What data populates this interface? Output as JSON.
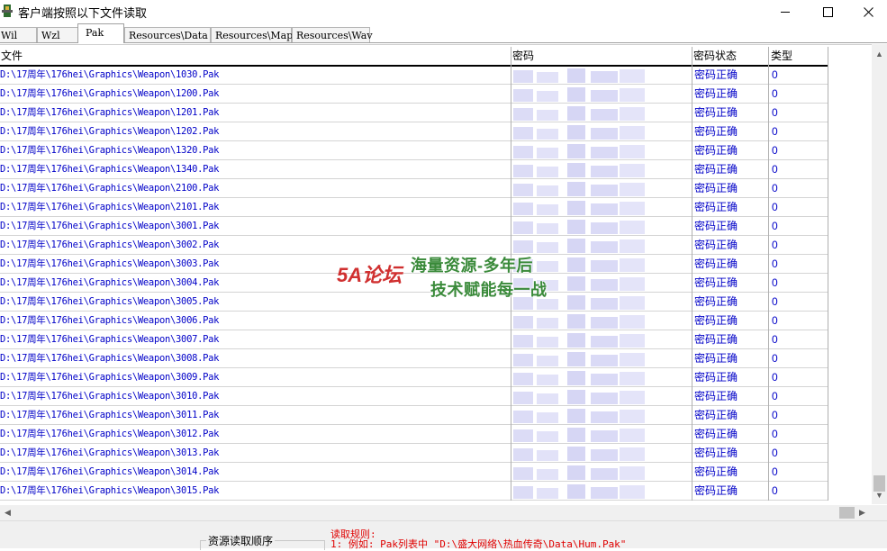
{
  "window": {
    "title": "客户端按照以下文件读取",
    "icon": "app-icon",
    "controls": [
      "minimize-icon",
      "maximize-icon",
      "close-icon"
    ]
  },
  "tabs": [
    {
      "label": "Wil",
      "active": false
    },
    {
      "label": "Wzl",
      "active": false
    },
    {
      "label": "Pak",
      "active": true
    },
    {
      "label": "Resources\\Data",
      "active": false
    },
    {
      "label": "Resources\\Map",
      "active": false
    },
    {
      "label": "Resources\\Wav",
      "active": false
    }
  ],
  "grid": {
    "columns": {
      "file": "文件",
      "password": "密码",
      "status": "密码状态",
      "type": "类型"
    },
    "rows": [
      {
        "file": "D:\\17周年\\176hei\\Graphics\\Weapon\\1030.Pak",
        "status": "密码正确",
        "type": "0"
      },
      {
        "file": "D:\\17周年\\176hei\\Graphics\\Weapon\\1200.Pak",
        "status": "密码正确",
        "type": "0"
      },
      {
        "file": "D:\\17周年\\176hei\\Graphics\\Weapon\\1201.Pak",
        "status": "密码正确",
        "type": "0"
      },
      {
        "file": "D:\\17周年\\176hei\\Graphics\\Weapon\\1202.Pak",
        "status": "密码正确",
        "type": "0"
      },
      {
        "file": "D:\\17周年\\176hei\\Graphics\\Weapon\\1320.Pak",
        "status": "密码正确",
        "type": "0"
      },
      {
        "file": "D:\\17周年\\176hei\\Graphics\\Weapon\\1340.Pak",
        "status": "密码正确",
        "type": "0"
      },
      {
        "file": "D:\\17周年\\176hei\\Graphics\\Weapon\\2100.Pak",
        "status": "密码正确",
        "type": "0"
      },
      {
        "file": "D:\\17周年\\176hei\\Graphics\\Weapon\\2101.Pak",
        "status": "密码正确",
        "type": "0"
      },
      {
        "file": "D:\\17周年\\176hei\\Graphics\\Weapon\\3001.Pak",
        "status": "密码正确",
        "type": "0"
      },
      {
        "file": "D:\\17周年\\176hei\\Graphics\\Weapon\\3002.Pak",
        "status": "密码正确",
        "type": "0"
      },
      {
        "file": "D:\\17周年\\176hei\\Graphics\\Weapon\\3003.Pak",
        "status": "密码正确",
        "type": "0"
      },
      {
        "file": "D:\\17周年\\176hei\\Graphics\\Weapon\\3004.Pak",
        "status": "密码正确",
        "type": "0"
      },
      {
        "file": "D:\\17周年\\176hei\\Graphics\\Weapon\\3005.Pak",
        "status": "密码正确",
        "type": "0"
      },
      {
        "file": "D:\\17周年\\176hei\\Graphics\\Weapon\\3006.Pak",
        "status": "密码正确",
        "type": "0"
      },
      {
        "file": "D:\\17周年\\176hei\\Graphics\\Weapon\\3007.Pak",
        "status": "密码正确",
        "type": "0"
      },
      {
        "file": "D:\\17周年\\176hei\\Graphics\\Weapon\\3008.Pak",
        "status": "密码正确",
        "type": "0"
      },
      {
        "file": "D:\\17周年\\176hei\\Graphics\\Weapon\\3009.Pak",
        "status": "密码正确",
        "type": "0"
      },
      {
        "file": "D:\\17周年\\176hei\\Graphics\\Weapon\\3010.Pak",
        "status": "密码正确",
        "type": "0"
      },
      {
        "file": "D:\\17周年\\176hei\\Graphics\\Weapon\\3011.Pak",
        "status": "密码正确",
        "type": "0"
      },
      {
        "file": "D:\\17周年\\176hei\\Graphics\\Weapon\\3012.Pak",
        "status": "密码正确",
        "type": "0"
      },
      {
        "file": "D:\\17周年\\176hei\\Graphics\\Weapon\\3013.Pak",
        "status": "密码正确",
        "type": "0"
      },
      {
        "file": "D:\\17周年\\176hei\\Graphics\\Weapon\\3014.Pak",
        "status": "密码正确",
        "type": "0"
      },
      {
        "file": "D:\\17周年\\176hei\\Graphics\\Weapon\\3015.Pak",
        "status": "密码正确",
        "type": "0"
      }
    ]
  },
  "bottom": {
    "group_label": "资源读取顺序",
    "rule_title": "读取规则:",
    "rule_line": "1: 例如: Pak列表中 \"D:\\盛大网络\\热血传奇\\Data\\Hum.Pak\""
  },
  "watermark": {
    "logo_text": "5A论坛",
    "line1": "海量资源-多年后",
    "line2": "技术赋能每一战"
  },
  "colors": {
    "link_text": "#0000c8",
    "rule_text": "#e00000",
    "watermark_green": "#3a8a3a"
  }
}
